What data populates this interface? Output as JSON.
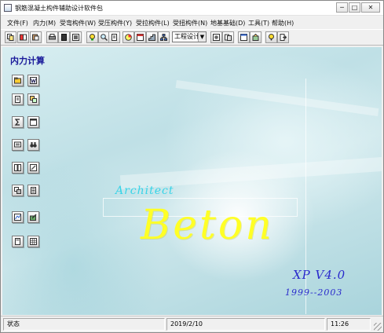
{
  "window": {
    "title": "钢筋混凝土构件辅助设计软件包",
    "controls": {
      "minimize": "─",
      "maximize": "□",
      "close": "✕"
    }
  },
  "menu": [
    "文件(F)",
    "内力(M)",
    "受弯构件(W)",
    "受压构件(Y)",
    "受拉构件(L)",
    "受扭构件(N)",
    "地基基础(D)",
    "工具(T)",
    "帮助(H)"
  ],
  "toolbar": {
    "buttons": [
      "copy",
      "cut",
      "paste",
      "print",
      "new",
      "report",
      "gallery",
      "zoom",
      "doc",
      "chart",
      "table",
      "stairs",
      "tree",
      "export",
      "import",
      "window",
      "design",
      "help",
      "exit"
    ],
    "select_value": "工程设计",
    "select_arrow": "▼"
  },
  "side_panel": {
    "title": "内力计算",
    "buttons": [
      "open",
      "word",
      "doc",
      "preview",
      "sum",
      "frame",
      "monitor",
      "binoculars",
      "columns",
      "edit",
      "tiles",
      "stack",
      "graph",
      "pen",
      "calc",
      "grid"
    ]
  },
  "splash": {
    "architect": "Architect",
    "beton": "Beton",
    "version": "XP V4.0",
    "years": "1999--2003"
  },
  "statusbar": {
    "status": "状态",
    "date": "2019/2/10",
    "time": "11:26"
  },
  "colors": {
    "panel_title": "#1a1a9a",
    "beton": "#ffff26",
    "architect": "#36d4e8",
    "version": "#2a2acc"
  }
}
